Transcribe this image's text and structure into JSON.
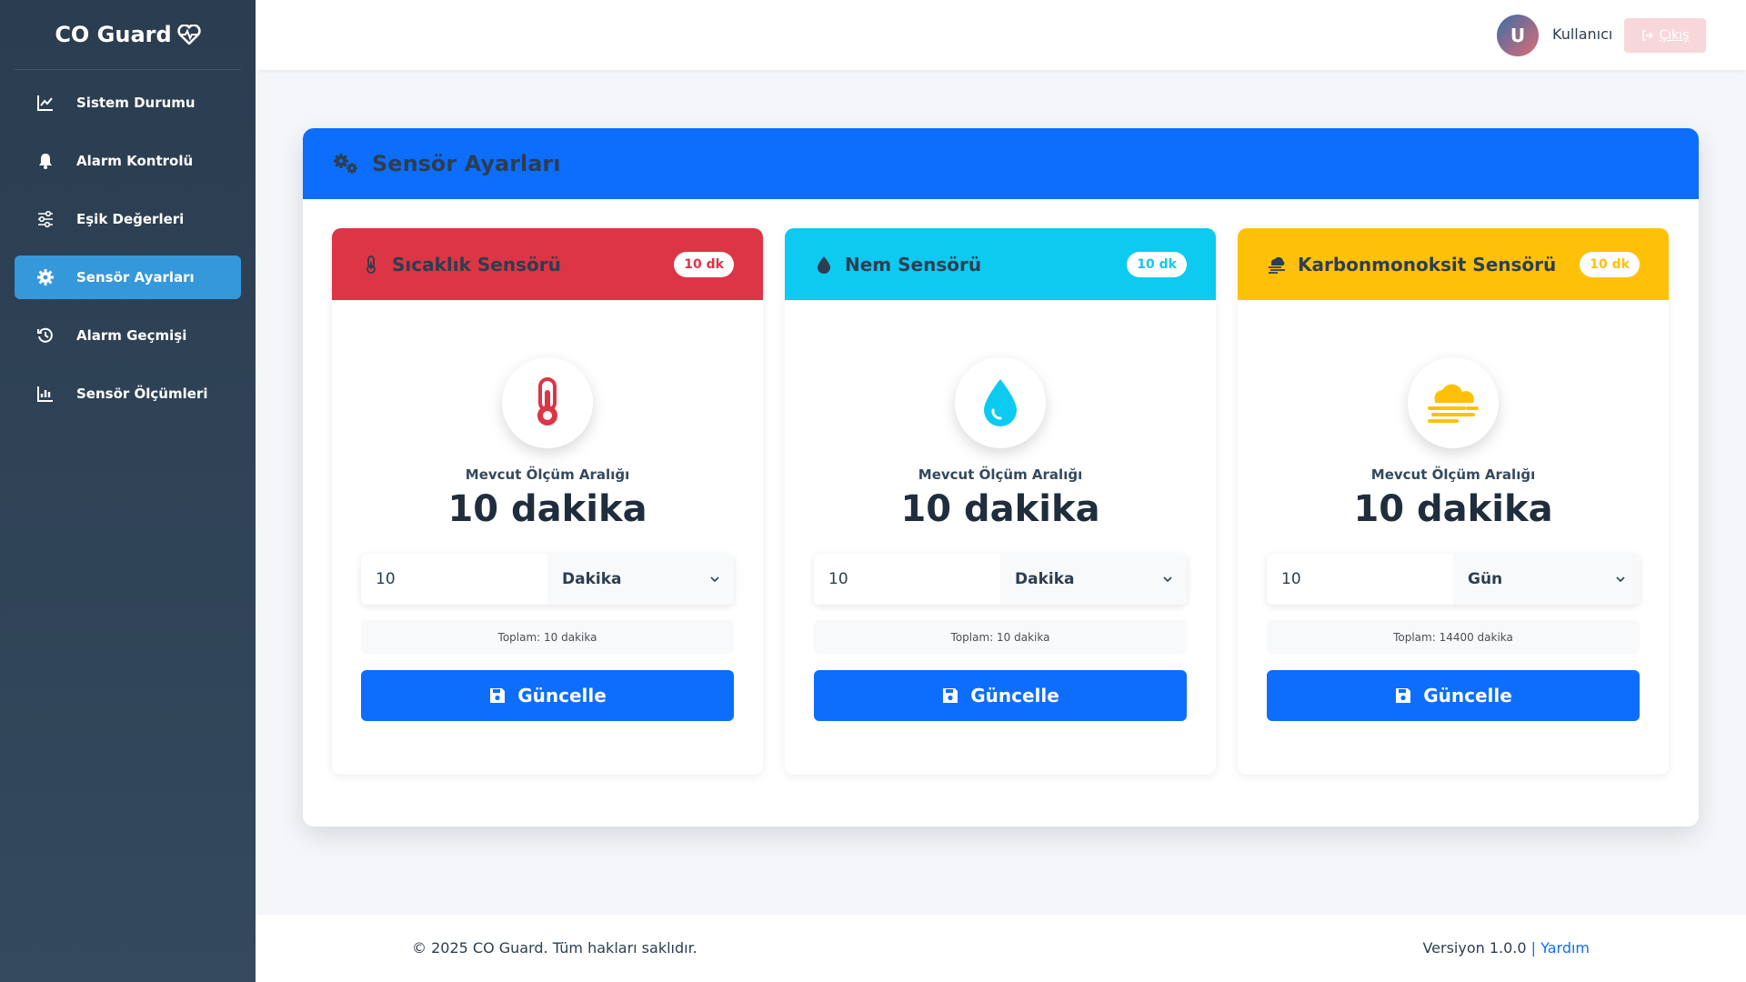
{
  "brand": {
    "name": "CO Guard",
    "icon": "heart-pulse-icon"
  },
  "sidebar": {
    "items": [
      {
        "label": "Sistem Durumu",
        "icon": "chart-line-icon",
        "active": false
      },
      {
        "label": "Alarm Kontrolü",
        "icon": "bell-icon",
        "active": false
      },
      {
        "label": "Eşik Değerleri",
        "icon": "sliders-icon",
        "active": false
      },
      {
        "label": "Sensör Ayarları",
        "icon": "gear-icon",
        "active": true
      },
      {
        "label": "Alarm Geçmişi",
        "icon": "history-icon",
        "active": false
      },
      {
        "label": "Sensör Ölçümleri",
        "icon": "chart-bar-icon",
        "active": false
      }
    ]
  },
  "topbar": {
    "avatar_initial": "U",
    "username": "Kullanıcı",
    "logout_label": "Çıkış"
  },
  "panel": {
    "title": "Sensör Ayarları",
    "icon": "gears-icon"
  },
  "cards": [
    {
      "title": "Sıcaklık Sensörü",
      "badge": "10 dk",
      "color": "#dc3545",
      "range_label": "Mevcut Ölçüm Aralığı",
      "range_value": "10 dakika",
      "input_value": "10",
      "unit": "Dakika",
      "total": "Toplam: 10 dakika",
      "button": "Güncelle"
    },
    {
      "title": "Nem Sensörü",
      "badge": "10 dk",
      "color": "#0dcaf0",
      "range_label": "Mevcut Ölçüm Aralığı",
      "range_value": "10 dakika",
      "input_value": "10",
      "unit": "Dakika",
      "total": "Toplam: 10 dakika",
      "button": "Güncelle"
    },
    {
      "title": "Karbonmonoksit Sensörü",
      "badge": "10 dk",
      "color": "#ffc107",
      "range_label": "Mevcut Ölçüm Aralığı",
      "range_value": "10 dakika",
      "input_value": "10",
      "unit": "Gün",
      "total": "Toplam: 14400 dakika",
      "button": "Güncelle"
    }
  ],
  "footer": {
    "copyright": "© 2025 CO Guard. Tüm hakları saklıdır.",
    "version": "Versiyon 1.0.0",
    "separator": "|",
    "help": "Yardım"
  }
}
